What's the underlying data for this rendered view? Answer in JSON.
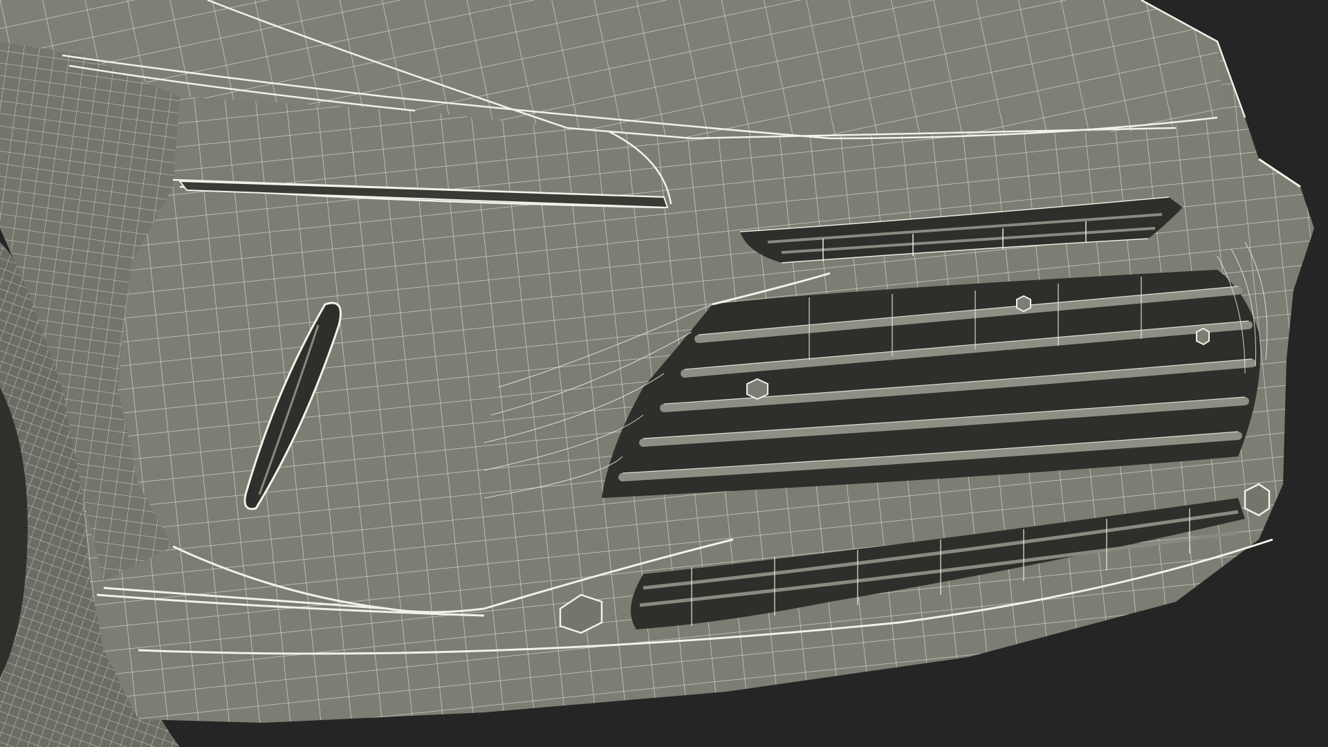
{
  "scene": {
    "subject": "car-front-wireframe",
    "colors": {
      "background": "#252525",
      "body_shade": "#7d7d73",
      "body_shade_dark": "#6f6f66",
      "wire": "#ecece4",
      "grille_cavity": "#2e2e2a",
      "grille_slat": "#86867c",
      "tire": "#6c6c64"
    }
  }
}
